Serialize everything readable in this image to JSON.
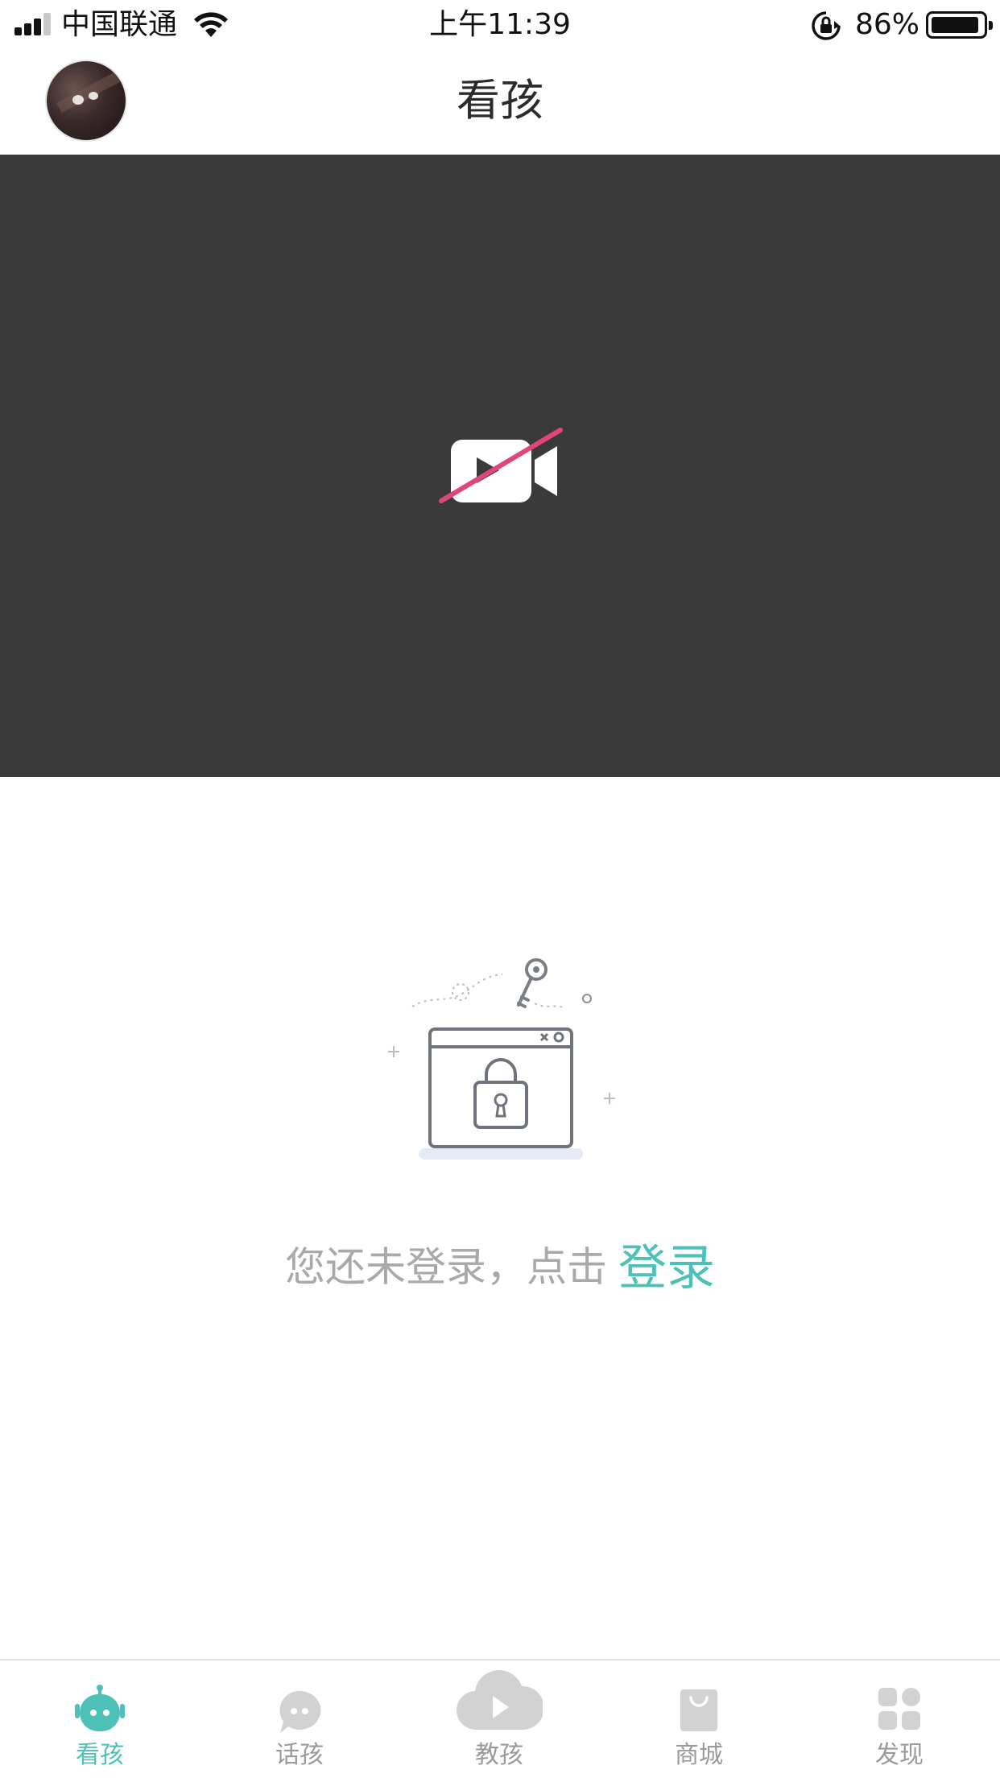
{
  "status_bar": {
    "carrier": "中国联通",
    "time": "上午11:39",
    "battery": "86%",
    "icons": [
      "signal-icon",
      "wifi-icon",
      "orientation-lock-icon",
      "battery-icon"
    ]
  },
  "header": {
    "title": "看孩",
    "avatar_icon": "avatar"
  },
  "video": {
    "icon": "camera-off-icon"
  },
  "login_prompt": {
    "illustration": "lock-illustration",
    "text": "您还未登录，点击",
    "link": "登录"
  },
  "colors": {
    "accent": "#4dc1b8",
    "video_bg": "#3a3a3a",
    "slash": "#e2457a",
    "inactive": "#c8c8c8",
    "prompt_text": "#a9a9a9"
  },
  "tabs": [
    {
      "label": "看孩",
      "icon": "robot-icon",
      "active": true
    },
    {
      "label": "话孩",
      "icon": "chat-icon",
      "active": false
    },
    {
      "label": "教孩",
      "icon": "cloud-play-icon",
      "active": false
    },
    {
      "label": "商城",
      "icon": "shopping-bag-icon",
      "active": false
    },
    {
      "label": "发现",
      "icon": "grid-icon",
      "active": false
    }
  ]
}
